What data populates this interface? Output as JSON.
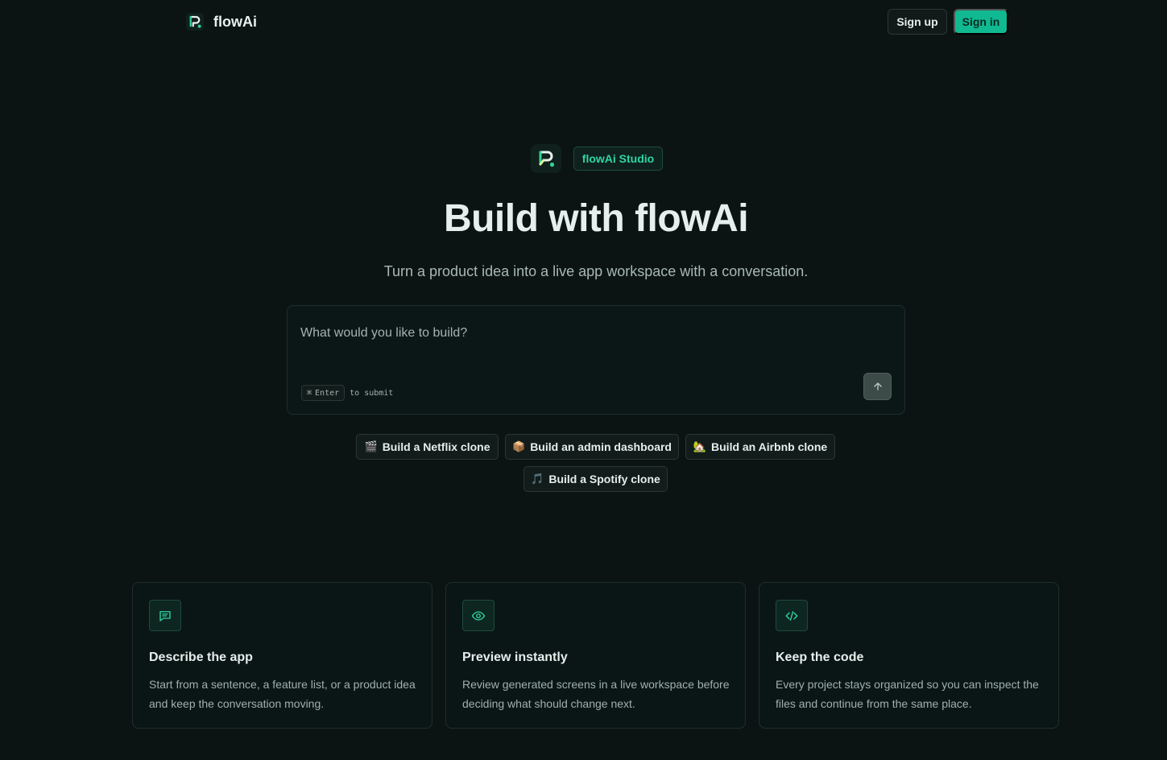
{
  "brand": {
    "name": "flowAi",
    "logo_icon": "flowai-logo-icon"
  },
  "nav": {
    "signup_label": "Sign up",
    "signin_label": "Sign in"
  },
  "hero": {
    "badge": "flowAi Studio",
    "title": "Build with flowAi",
    "subtitle": "Turn a product idea into a live app workspace with a conversation."
  },
  "prompt": {
    "placeholder": "What would you like to build?",
    "kbd_symbol": "⌘",
    "kbd_key": "Enter",
    "hint_text": "to submit",
    "send_icon": "arrow-up-icon"
  },
  "suggestions": [
    {
      "emoji": "🎬",
      "label": "Build a Netflix clone"
    },
    {
      "emoji": "📦",
      "label": "Build an admin dashboard"
    },
    {
      "emoji": "🏡",
      "label": "Build an Airbnb clone"
    },
    {
      "emoji": "🎵",
      "label": "Build a Spotify clone"
    }
  ],
  "features": [
    {
      "icon": "chat-icon",
      "title": "Describe the app",
      "desc": "Start from a sentence, a feature list, or a product idea and keep the conversation moving."
    },
    {
      "icon": "eye-icon",
      "title": "Preview instantly",
      "desc": "Review generated screens in a live workspace before deciding what should change next."
    },
    {
      "icon": "code-icon",
      "title": "Keep the code",
      "desc": "Every project stays organized so you can inspect the files and continue from the same place."
    }
  ],
  "colors": {
    "background": "#0b1413",
    "accent": "#10b991",
    "accent_text": "#2fd6a5"
  }
}
